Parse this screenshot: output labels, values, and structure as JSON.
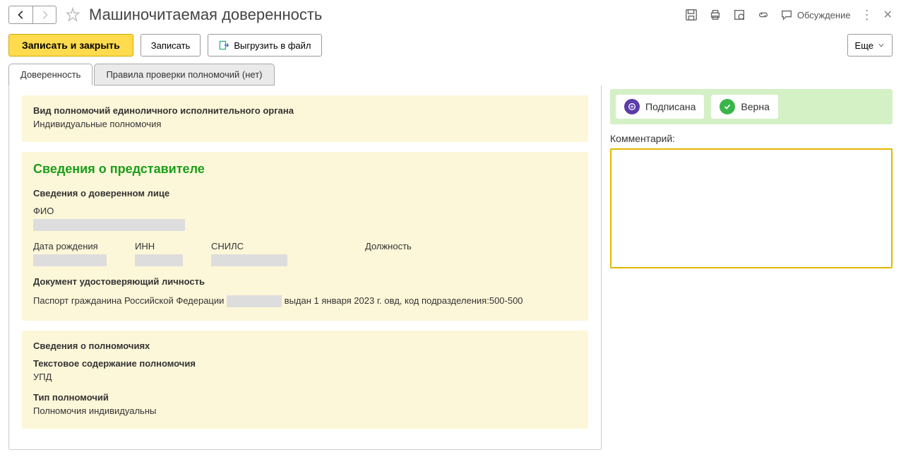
{
  "header": {
    "title": "Машиночитаемая доверенность",
    "discuss": "Обсуждение"
  },
  "toolbar": {
    "save_close": "Записать и закрыть",
    "save": "Записать",
    "export": "Выгрузить в файл",
    "more": "Еще"
  },
  "tabs": {
    "tab1": "Доверенность",
    "tab2": "Правила проверки полномочий (нет)"
  },
  "block1": {
    "heading": "Вид полномочий единоличного исполнительного органа",
    "text": "Индивидуальные полномочия"
  },
  "block2": {
    "title": "Сведения о представителе",
    "sub1": "Сведения о доверенном лице",
    "fio_label": "ФИО",
    "birth_label": "Дата рождения",
    "inn_label": "ИНН",
    "snils_label": "СНИЛС",
    "position_label": "Должность",
    "doc_heading": "Документ удостоверяющий личность",
    "doc_type": "Паспорт гражданина Российской Федерации",
    "doc_issued": "выдан 1 января 2023 г. овд, код подразделения:500-500"
  },
  "block3": {
    "heading": "Сведения о полномочиях",
    "text_heading": "Текстовое содержание полномочия",
    "text_value": "УПД",
    "type_heading": "Тип полномочий",
    "type_value": "Полномочия индивидуальны"
  },
  "status": {
    "signed": "Подписана",
    "valid": "Верна"
  },
  "comment": {
    "label": "Комментарий:",
    "value": ""
  }
}
